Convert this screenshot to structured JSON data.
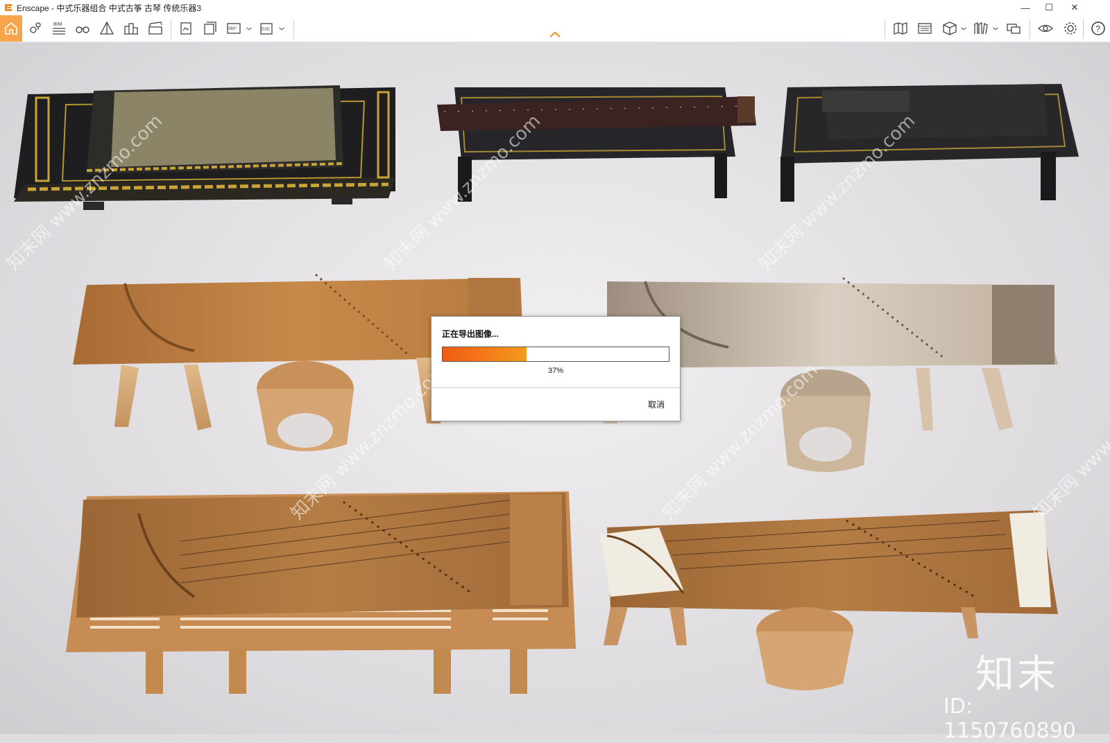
{
  "window": {
    "app_name": "Enscape",
    "title": "Enscape - 中式乐器组合 中式古筝 古琴 传统乐器3",
    "controls": [
      "minimize-icon",
      "maximize-icon",
      "close-icon"
    ]
  },
  "toolbar": {
    "left_icons": [
      "home-icon",
      "location-pin-icon",
      "bim-icon",
      "binoculars-icon",
      "perspective-icon",
      "buildings-icon",
      "clapperboard-icon",
      "export-image-icon",
      "export-batch-icon",
      "export-360-icon",
      "export-exe-icon"
    ],
    "bim_label": "BIM",
    "pano_label": "360°",
    "exe_label": "EXE",
    "right_icons": [
      "map-icon",
      "panel-icon",
      "cube-icon",
      "asset-library-icon",
      "chat-icon",
      "eye-icon",
      "settings-icon",
      "help-icon"
    ],
    "accent": "#f7a54b"
  },
  "dialog": {
    "title": "正在导出图像...",
    "progress": 0.37,
    "progress_label": "37%",
    "cancel_label": "取消"
  },
  "watermark": {
    "brand": "知末",
    "id_text": "ID: 1150760890",
    "repeat_text": "知末网 www.znzmo.com"
  }
}
